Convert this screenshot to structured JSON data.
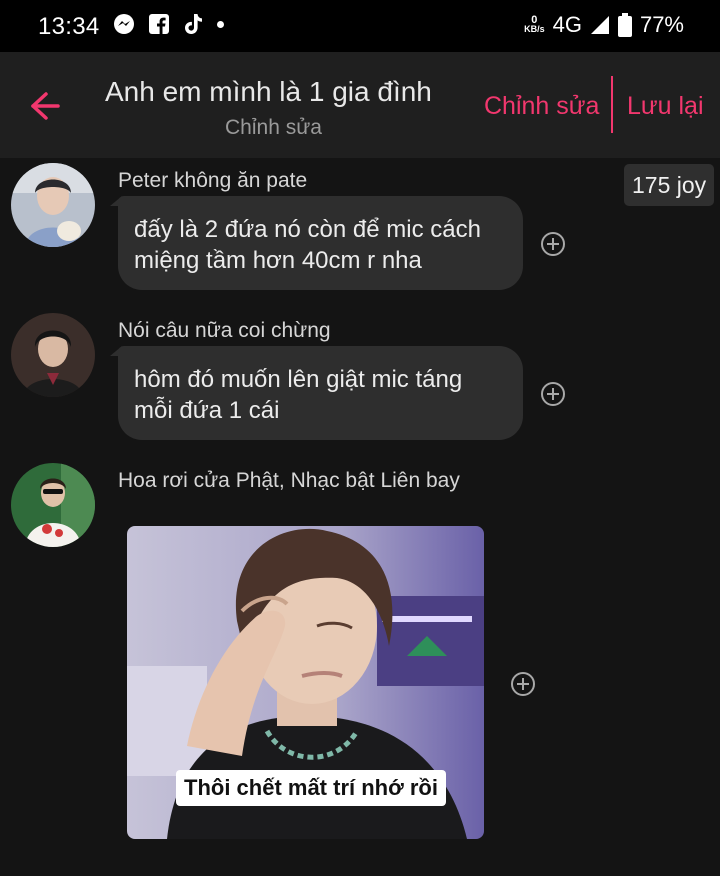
{
  "status": {
    "time": "13:34",
    "net_speed_value": "0",
    "net_speed_unit": "KB/s",
    "network": "4G",
    "battery": "77%",
    "left_icons": [
      "messenger-icon",
      "facebook-icon",
      "tiktok-icon",
      "dot-icon"
    ]
  },
  "header": {
    "title": "Anh em mình là 1 gia đình",
    "subtitle": "Chỉnh sửa",
    "edit_label": "Chỉnh sửa",
    "save_label": "Lưu lại",
    "accent": "#f2376e"
  },
  "joy_badge": "175 joy",
  "messages": [
    {
      "sender": "Peter không ăn pate",
      "line1": "đấy là 2 đứa nó còn để mic cách",
      "line2": "miệng tầm hơn 40cm r nha"
    },
    {
      "sender": "Nói câu nữa coi chừng",
      "line1": "hôm đó muốn lên giật mic táng",
      "line2": "mỗi đứa 1 cái"
    },
    {
      "sender": "Hoa rơi cửa Phật, Nhạc bật Liên bay",
      "image_caption": "Thôi chết mất trí nhớ rồi"
    }
  ]
}
